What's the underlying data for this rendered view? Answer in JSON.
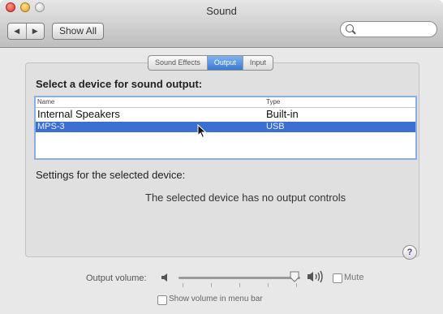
{
  "window": {
    "title": "Sound",
    "show_all_label": "Show All",
    "back_glyph": "◀",
    "forward_glyph": "▶",
    "search_placeholder": ""
  },
  "tabs": [
    {
      "label": "Sound Effects",
      "active": false
    },
    {
      "label": "Output",
      "active": true
    },
    {
      "label": "Input",
      "active": false
    }
  ],
  "output": {
    "prompt": "Select a device for sound output:",
    "columns": {
      "name": "Name",
      "type": "Type"
    },
    "devices": [
      {
        "name": "Internal Speakers",
        "type": "Built-in",
        "selected": false
      },
      {
        "name": "MPS-3",
        "type": "USB",
        "selected": true
      }
    ],
    "settings_label": "Settings for the selected device:",
    "no_controls_message": "The selected device has no output controls"
  },
  "help_glyph": "?",
  "volume": {
    "label": "Output volume:",
    "level": 0.95,
    "mute_label": "Mute",
    "mute_checked": false,
    "menubar_label": "Show volume in menu bar",
    "menubar_checked": false
  },
  "colors": {
    "selection": "#3c6fd2",
    "focus_ring": "#87aee6",
    "active_tab": "#3b79d4"
  }
}
